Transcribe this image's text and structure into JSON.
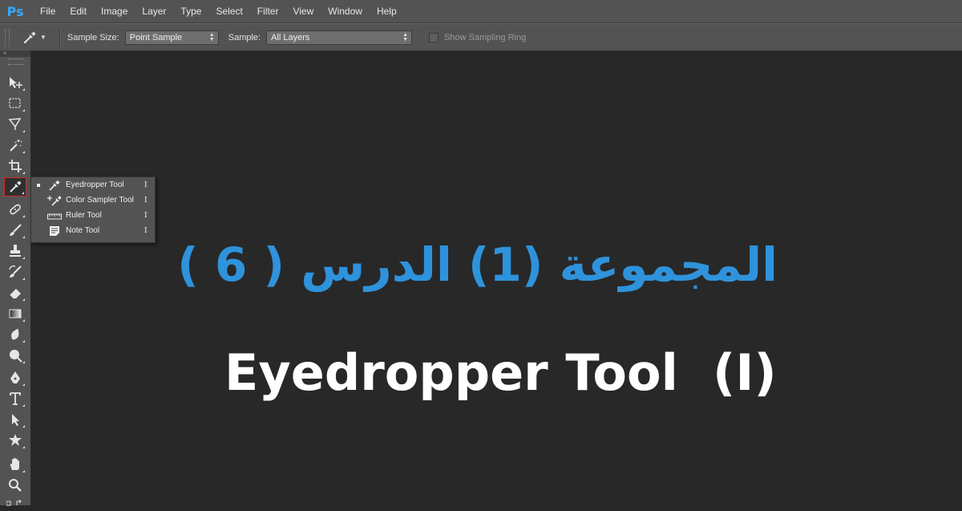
{
  "app": {
    "logo": "Ps",
    "accent_color": "#31a8ff"
  },
  "menu": [
    "File",
    "Edit",
    "Image",
    "Layer",
    "Type",
    "Select",
    "Filter",
    "View",
    "Window",
    "Help"
  ],
  "options": {
    "sample_size_label": "Sample Size:",
    "sample_size_value": "Point Sample",
    "sample_label": "Sample:",
    "sample_value": "All Layers",
    "sampling_ring_label": "Show Sampling Ring"
  },
  "toolbox": {
    "active_tool": "eyedropper-icon",
    "tools": [
      "move-icon",
      "marquee-icon",
      "lasso-icon",
      "magic-wand-icon",
      "crop-icon",
      "eyedropper-icon",
      "healing-brush-icon",
      "brush-icon",
      "clone-stamp-icon",
      "history-brush-icon",
      "eraser-icon",
      "gradient-icon",
      "blur-icon",
      "dodge-icon",
      "pen-icon",
      "type-icon",
      "path-selection-icon",
      "shape-icon",
      "hand-icon",
      "zoom-icon"
    ]
  },
  "flyout": {
    "items": [
      {
        "label": "Eyedropper Tool",
        "key": "I",
        "icon": "eyedropper-icon",
        "selected": true
      },
      {
        "label": "Color Sampler Tool",
        "key": "I",
        "icon": "color-sampler-icon",
        "selected": false
      },
      {
        "label": "Ruler Tool",
        "key": "I",
        "icon": "ruler-icon",
        "selected": false
      },
      {
        "label": "Note Tool",
        "key": "I",
        "icon": "note-icon",
        "selected": false
      }
    ]
  },
  "canvas": {
    "title_ar": "المجموعة (1) الدرس ( 6 )",
    "title_en": "Eyedropper Tool  (I)",
    "title_ar_color": "#2e93dc",
    "title_en_color": "#ffffff"
  }
}
